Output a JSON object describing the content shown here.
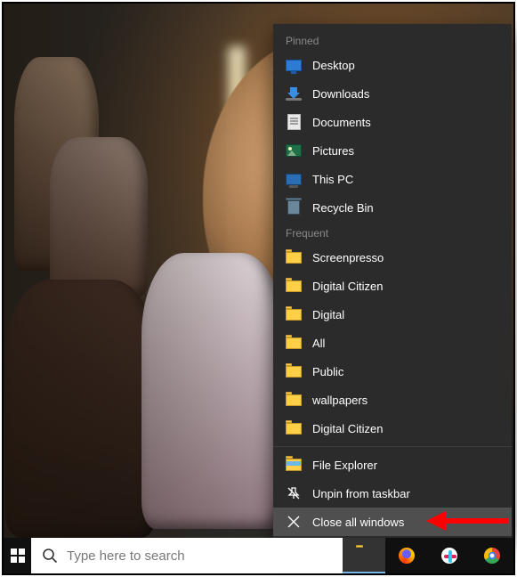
{
  "taskbar": {
    "search_placeholder": "Type here to search",
    "apps": [
      {
        "name": "file-explorer",
        "active": true
      },
      {
        "name": "firefox",
        "active": false
      },
      {
        "name": "slack",
        "active": false
      },
      {
        "name": "chrome",
        "active": false
      }
    ]
  },
  "jumplist": {
    "sections": {
      "pinned": {
        "label": "Pinned",
        "items": [
          {
            "icon": "desktop",
            "label": "Desktop"
          },
          {
            "icon": "downloads",
            "label": "Downloads"
          },
          {
            "icon": "documents",
            "label": "Documents"
          },
          {
            "icon": "pictures",
            "label": "Pictures"
          },
          {
            "icon": "thispc",
            "label": "This PC"
          },
          {
            "icon": "recycle",
            "label": "Recycle Bin"
          }
        ]
      },
      "frequent": {
        "label": "Frequent",
        "items": [
          {
            "icon": "folder",
            "label": "Screenpresso"
          },
          {
            "icon": "folder",
            "label": "Digital Citizen"
          },
          {
            "icon": "folder",
            "label": "Digital"
          },
          {
            "icon": "folder",
            "label": "All"
          },
          {
            "icon": "folder",
            "label": "Public"
          },
          {
            "icon": "folder",
            "label": "wallpapers"
          },
          {
            "icon": "folder",
            "label": "Digital Citizen"
          }
        ]
      }
    },
    "actions": {
      "app_label": "File Explorer",
      "unpin_label": "Unpin from taskbar",
      "close_label": "Close all windows"
    }
  },
  "annotation": {
    "target": "close-all-windows"
  }
}
